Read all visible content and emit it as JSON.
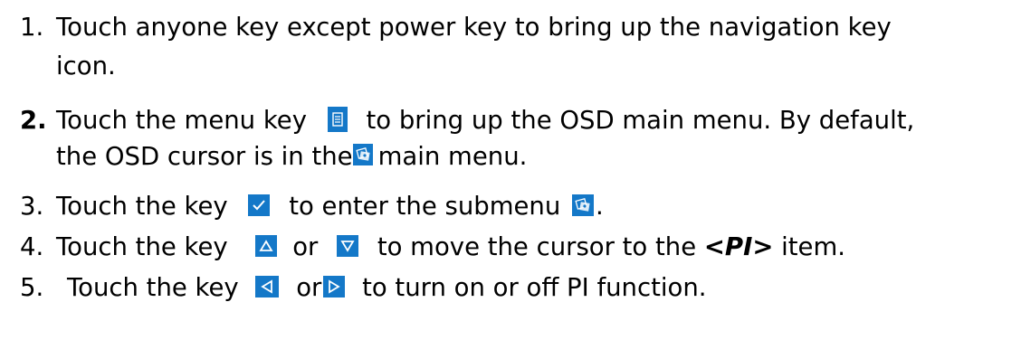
{
  "colors": {
    "icon_bg": "#1478C8",
    "icon_glyph": "#ffffff"
  },
  "steps": [
    {
      "number": "1.",
      "line1": "Touch anyone key except power key to bring up the navigation key",
      "line2": "icon."
    },
    {
      "number": "2.",
      "before_menu_icon": "Touch the menu key",
      "after_menu_icon": "to bring up the OSD main menu. By default,",
      "line2_before_icon": "the OSD cursor is in the",
      "line2_after_icon": "main menu.",
      "menu_icon": "menu-key-icon",
      "picture_icon": "picture-menu-icon"
    },
    {
      "number": "3.",
      "before_icon": "Touch the key",
      "middle": "to enter the submenu",
      "end": ".",
      "confirm_icon": "confirm-key-icon",
      "submenu_icon": "picture-menu-icon"
    },
    {
      "number": "4.",
      "before_icon": "Touch the key",
      "or": "or",
      "after_icons": "to move the cursor to the",
      "item": "<PI>",
      "end": "item.",
      "up_icon": "up-key-icon",
      "down_icon": "down-key-icon"
    },
    {
      "number": "5.",
      "before_icon": "Touch the key",
      "or": "or",
      "after_icons": "to turn on or off PI function.",
      "left_icon": "left-key-icon",
      "right_icon": "right-key-icon"
    }
  ]
}
